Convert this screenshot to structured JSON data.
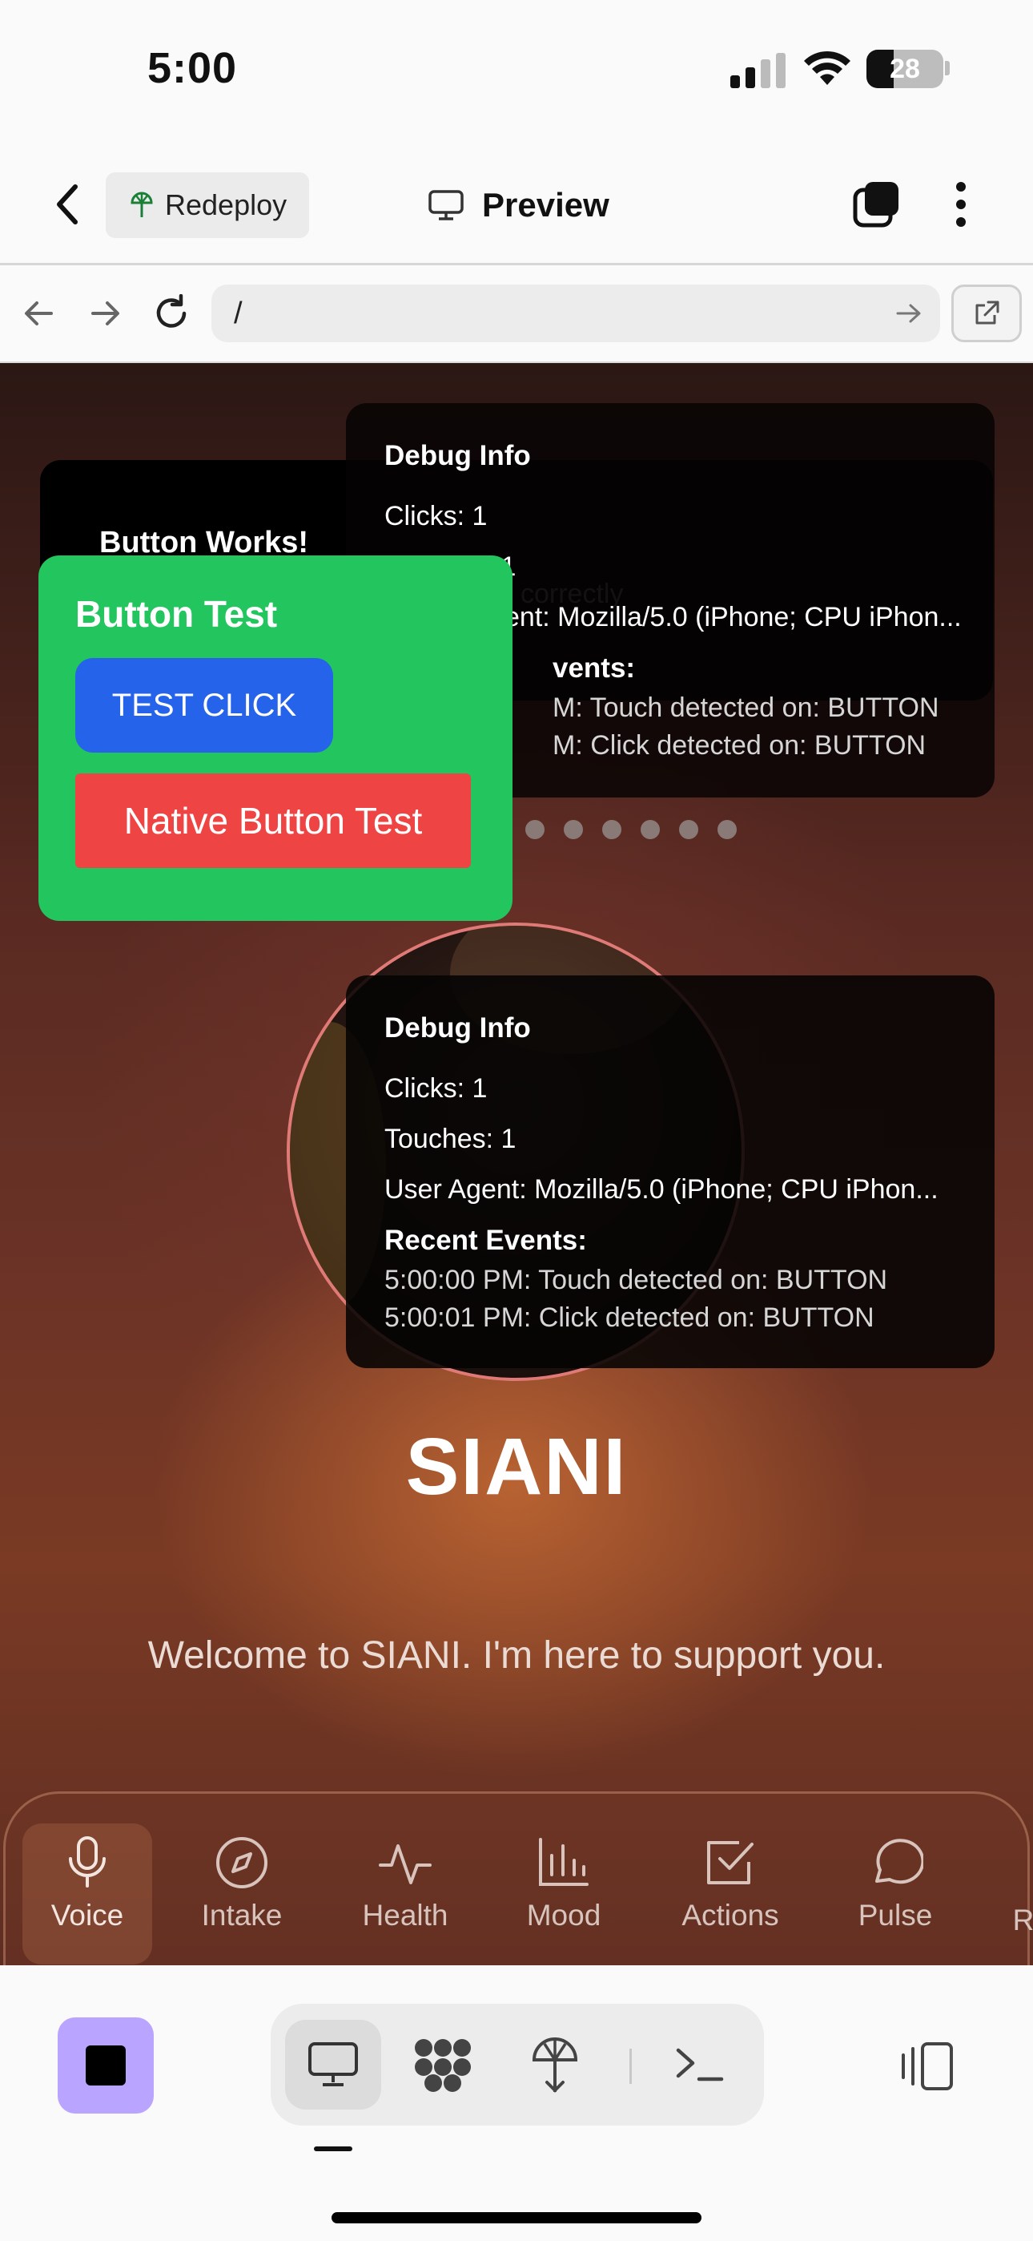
{
  "status_bar": {
    "time": "5:00",
    "battery": "28"
  },
  "header": {
    "redeploy_label": "Redeploy",
    "title": "Preview"
  },
  "browser": {
    "url": "/"
  },
  "debug_top": {
    "title": "Debug Info",
    "clicks": "Clicks: 1",
    "touches_partial": "Touches: 1",
    "user_agent_partial": "ent: Mozilla/5.0 (iPhone; CPU iPhon...",
    "recent_partial": "vents:",
    "event1_partial": "M: Touch detected on: BUTTON",
    "event2_partial": "M: Click detected on: BUTTON"
  },
  "button_works": {
    "title": "Button Works!",
    "subtitle_partial": "correctly"
  },
  "button_test": {
    "title": "Button Test",
    "test_click": "TEST CLICK",
    "native": "Native Button Test"
  },
  "debug_bottom": {
    "title": "Debug Info",
    "clicks": "Clicks: 1",
    "touches": "Touches: 1",
    "user_agent": "User Agent: Mozilla/5.0 (iPhone; CPU iPhon...",
    "recent": "Recent Events:",
    "event1": "5:00:00 PM: Touch detected on: BUTTON",
    "event2": "5:00:01 PM: Click detected on: BUTTON"
  },
  "hero": {
    "title": "SIANI",
    "welcome": "Welcome to SIANI. I'm here to support you."
  },
  "nav": {
    "items": [
      {
        "label": "Voice",
        "icon": "mic-icon"
      },
      {
        "label": "Intake",
        "icon": "compass-icon"
      },
      {
        "label": "Health",
        "icon": "activity-icon"
      },
      {
        "label": "Mood",
        "icon": "bar-chart-icon"
      },
      {
        "label": "Actions",
        "icon": "check-square-icon"
      },
      {
        "label": "Pulse",
        "icon": "chat-bubble-icon"
      },
      {
        "label": "R",
        "icon": ""
      }
    ]
  },
  "colors": {
    "accent_green": "#22c55e",
    "accent_blue": "#2563eb",
    "accent_red": "#ef4444",
    "stop_purple": "#b9a4ff"
  }
}
